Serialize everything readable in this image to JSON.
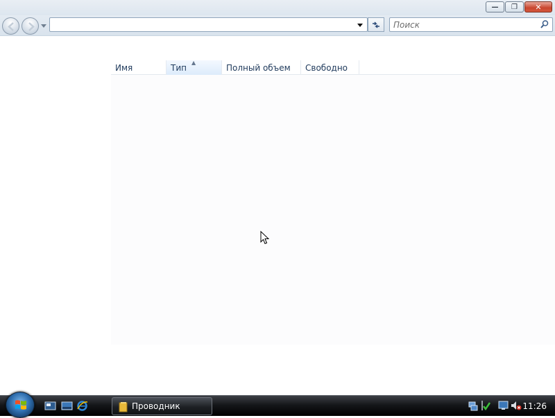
{
  "window": {
    "minimize_label": "—",
    "maximize_label": "❐",
    "close_label": "✕"
  },
  "nav": {
    "address_value": "",
    "search_placeholder": "Поиск"
  },
  "file_list": {
    "columns": [
      {
        "label": "Имя",
        "sorted": false
      },
      {
        "label": "Тип",
        "sorted": true
      },
      {
        "label": "Полный объем",
        "sorted": false
      },
      {
        "label": "Свободно",
        "sorted": false
      }
    ]
  },
  "taskbar": {
    "task_button_label": "Проводник",
    "clock": "11:26"
  },
  "colors": {
    "accent": "#1e395b",
    "taskbar": "#15171a"
  },
  "icons": {
    "back": "back-arrow-icon",
    "forward": "forward-arrow-icon",
    "refresh": "refresh-icon",
    "search": "search-icon",
    "start": "windows-logo-icon",
    "folder": "folder-icon",
    "cursor": "mouse-pointer-icon"
  }
}
